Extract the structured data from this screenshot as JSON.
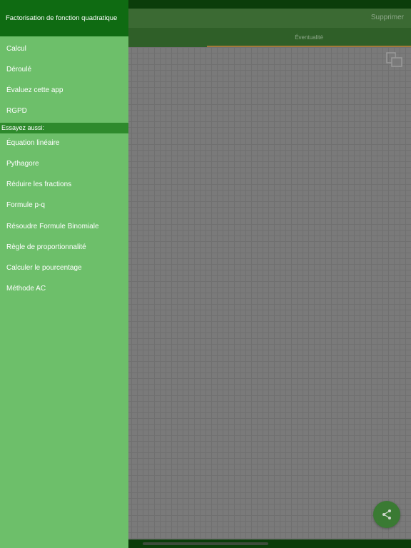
{
  "sidebar": {
    "title": "Factorisation de fonction quadratique",
    "items": [
      {
        "label": "Calcul"
      },
      {
        "label": "Déroulé"
      },
      {
        "label": "Évaluez cette app"
      },
      {
        "label": "RGPD"
      }
    ],
    "section_label": "Essayez aussi:",
    "related": [
      {
        "label": "Équation linéaire"
      },
      {
        "label": "Pythagore"
      },
      {
        "label": "Réduire les fractions"
      },
      {
        "label": "Formule p-q"
      },
      {
        "label": "Résoudre Formule Binomiale"
      },
      {
        "label": "Règle de proportionnalité"
      },
      {
        "label": "Calculer le pourcentage"
      },
      {
        "label": "Méthode AC"
      }
    ]
  },
  "toolbar": {
    "delete_label": "Supprimer"
  },
  "tabs": [
    {
      "label": "Éventualité"
    }
  ],
  "icons": {
    "copy": "copy-icon",
    "share": "share-icon"
  },
  "colors": {
    "header": "#0f6b12",
    "sidebar": "#6dbf6a",
    "section": "#2e8a2c"
  }
}
